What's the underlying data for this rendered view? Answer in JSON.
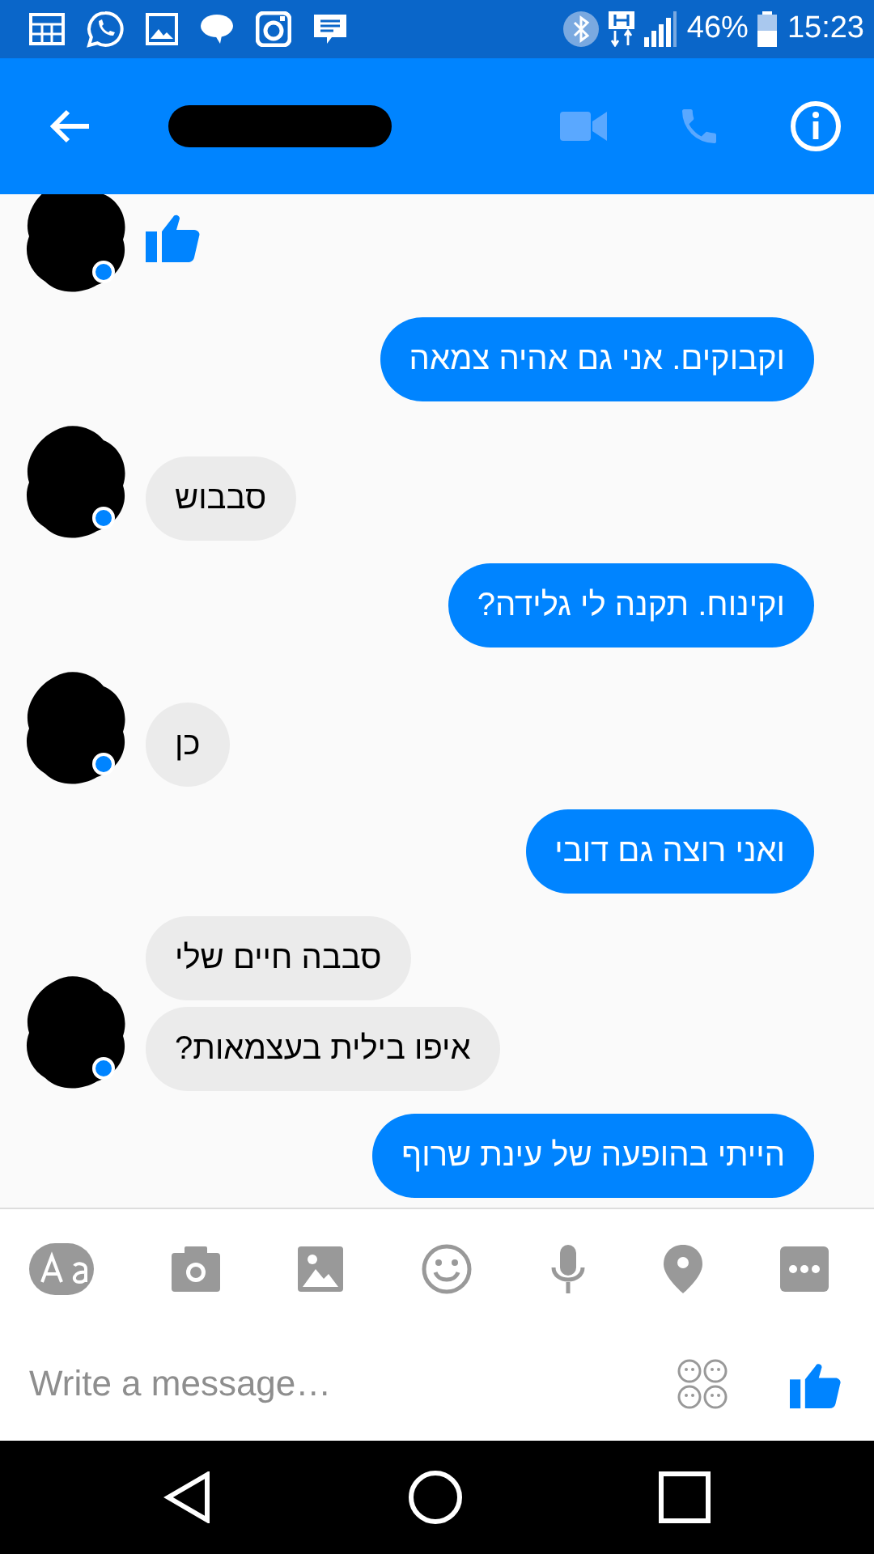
{
  "status_bar": {
    "battery": "46%",
    "time": "15:23"
  },
  "conversation": [
    {
      "outgoing": false,
      "items": [
        {
          "kind": "like"
        }
      ]
    },
    {
      "outgoing": true,
      "items": [
        {
          "kind": "text",
          "text": "וקבוקים. אני גם אהיה צמאה"
        }
      ]
    },
    {
      "outgoing": false,
      "items": [
        {
          "kind": "text",
          "text": "סבבוש"
        }
      ]
    },
    {
      "outgoing": true,
      "items": [
        {
          "kind": "text",
          "text": "וקינוח. תקנה לי גלידה?"
        }
      ]
    },
    {
      "outgoing": false,
      "items": [
        {
          "kind": "text",
          "text": "כן"
        }
      ]
    },
    {
      "outgoing": true,
      "items": [
        {
          "kind": "text",
          "text": "ואני רוצה גם דובי"
        }
      ]
    },
    {
      "outgoing": false,
      "items": [
        {
          "kind": "text",
          "text": "סבבה חיים שלי"
        },
        {
          "kind": "text",
          "text": "איפו בילית בעצמאות?"
        }
      ]
    },
    {
      "outgoing": true,
      "items": [
        {
          "kind": "text",
          "text": "הייתי בהופעה של עינת שרוף"
        }
      ]
    }
  ],
  "composer": {
    "placeholder": "Write a message…"
  }
}
